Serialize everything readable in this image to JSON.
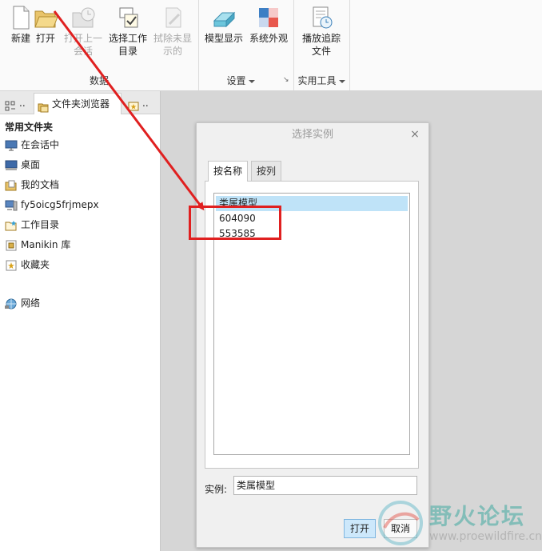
{
  "ribbon": {
    "buttons": [
      {
        "label": "新建",
        "icon": "new-file-icon",
        "enabled": true
      },
      {
        "label": "打开",
        "icon": "open-folder-icon",
        "enabled": true
      },
      {
        "label": "打开上一会话",
        "icon": "open-session-icon",
        "enabled": false
      },
      {
        "label": "选择工作目录",
        "icon": "working-directory-icon",
        "enabled": true
      },
      {
        "label": "拭除未显示的",
        "icon": "erase-icon",
        "enabled": false
      },
      {
        "label": "模型显示",
        "icon": "model-display-icon",
        "enabled": true
      },
      {
        "label": "系统外观",
        "icon": "system-appearance-icon",
        "enabled": true
      },
      {
        "label": "播放追踪文件",
        "icon": "play-trail-icon",
        "enabled": true
      }
    ],
    "groups": {
      "data": "数据",
      "settings": "设置",
      "tools": "实用工具"
    }
  },
  "left_pane": {
    "tabs": {
      "model_tree": "..",
      "folder_browser": "文件夹浏览器",
      "favorites": ".."
    },
    "section_title": "常用文件夹",
    "items": [
      {
        "label": "在会话中",
        "icon": "session-monitor-icon"
      },
      {
        "label": "桌面",
        "icon": "desktop-icon"
      },
      {
        "label": "我的文档",
        "icon": "documents-icon"
      },
      {
        "label": "fy5oicg5frjmepx",
        "icon": "computer-icon"
      },
      {
        "label": "工作目录",
        "icon": "working-folder-icon"
      },
      {
        "label": "Manikin 库",
        "icon": "library-icon"
      },
      {
        "label": "收藏夹",
        "icon": "favorites-icon"
      }
    ],
    "network": {
      "label": "网络",
      "icon": "network-icon"
    }
  },
  "dialog": {
    "title": "选择实例",
    "close": "×",
    "tabs": {
      "by_name": "按名称",
      "by_column": "按列"
    },
    "list": [
      "类属模型",
      "604090",
      "553585"
    ],
    "selected_index": 0,
    "instance_label": "实例:",
    "instance_value": "类属模型",
    "open_button": "打开",
    "cancel_button": "取消"
  },
  "watermark": {
    "text": "野火论坛",
    "url": "www.proewildfire.cn"
  },
  "colors": {
    "annotation": "#e02020",
    "selection": "#bfe3f8",
    "primary_button": "#cde8fb"
  }
}
